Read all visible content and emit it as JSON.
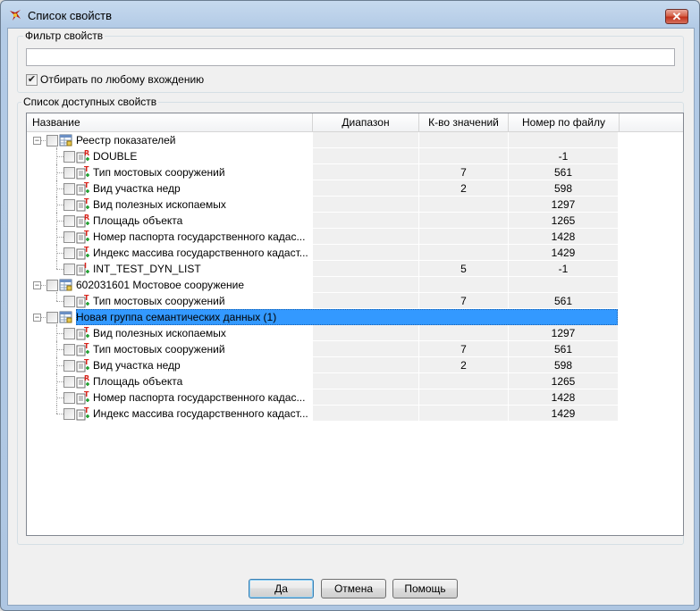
{
  "window": {
    "title": "Список свойств"
  },
  "filter": {
    "group_label": "Фильтр свойств",
    "value": "",
    "any_match_label": "Отбирать по любому вхождению",
    "any_match_checked": true
  },
  "list": {
    "group_label": "Список доступных свойств",
    "columns": [
      "Название",
      "Диапазон",
      "К-во значений",
      "Номер по файлу"
    ],
    "rows": [
      {
        "level": 0,
        "label": "Реестр показателей",
        "icon": "table-group-icon",
        "count": "",
        "num": "",
        "expander": "−"
      },
      {
        "level": 1,
        "label": "DOUBLE",
        "icon": "real-attribute-icon",
        "count": "",
        "num": "-1"
      },
      {
        "level": 1,
        "label": "Тип мостовых сооружений",
        "icon": "text-attribute-icon",
        "count": "7",
        "num": "561"
      },
      {
        "level": 1,
        "label": "Вид участка недр",
        "icon": "text-attribute-icon",
        "count": "2",
        "num": "598"
      },
      {
        "level": 1,
        "label": "Вид полезных ископаемых",
        "icon": "text-attribute-icon",
        "count": "",
        "num": "1297"
      },
      {
        "level": 1,
        "label": "Площадь объекта",
        "icon": "real-attribute-icon",
        "count": "",
        "num": "1265"
      },
      {
        "level": 1,
        "label": "Номер паспорта государственного кадас...",
        "icon": "text-attribute-icon",
        "count": "",
        "num": "1428"
      },
      {
        "level": 1,
        "label": "Индекс массива государственного кадаст...",
        "icon": "text-attribute-icon",
        "count": "",
        "num": "1429"
      },
      {
        "level": 1,
        "label": "INT_TEST_DYN_LIST",
        "icon": "integer-attribute-icon",
        "count": "5",
        "num": "-1",
        "last": true
      },
      {
        "level": 0,
        "label": "602031601 Мостовое сооружение",
        "icon": "table-group-icon",
        "count": "",
        "num": "",
        "expander": "−"
      },
      {
        "level": 1,
        "label": "Тип мостовых сооружений",
        "icon": "text-attribute-icon",
        "count": "7",
        "num": "561",
        "last": true
      },
      {
        "level": 0,
        "label": "Новая группа семантических данных (1)",
        "icon": "table-group-icon",
        "count": "",
        "num": "",
        "expander": "−",
        "selected": true
      },
      {
        "level": 1,
        "label": "Вид полезных ископаемых",
        "icon": "text-attribute-icon",
        "count": "",
        "num": "1297"
      },
      {
        "level": 1,
        "label": "Тип мостовых сооружений",
        "icon": "text-attribute-icon",
        "count": "7",
        "num": "561"
      },
      {
        "level": 1,
        "label": "Вид участка недр",
        "icon": "text-attribute-icon",
        "count": "2",
        "num": "598"
      },
      {
        "level": 1,
        "label": "Площадь объекта",
        "icon": "real-attribute-icon",
        "count": "",
        "num": "1265"
      },
      {
        "level": 1,
        "label": "Номер паспорта государственного кадас...",
        "icon": "text-attribute-icon",
        "count": "",
        "num": "1428"
      },
      {
        "level": 1,
        "label": "Индекс массива государственного кадаст...",
        "icon": "text-attribute-icon",
        "count": "",
        "num": "1429",
        "last": true
      }
    ]
  },
  "buttons": {
    "ok": "Да",
    "cancel": "Отмена",
    "help": "Помощь"
  },
  "colors": {
    "selection": "#3399ff",
    "text_attr": "#d8221a",
    "attr_plus": "#1a9c2a",
    "header_border": "#d5d5d5"
  }
}
